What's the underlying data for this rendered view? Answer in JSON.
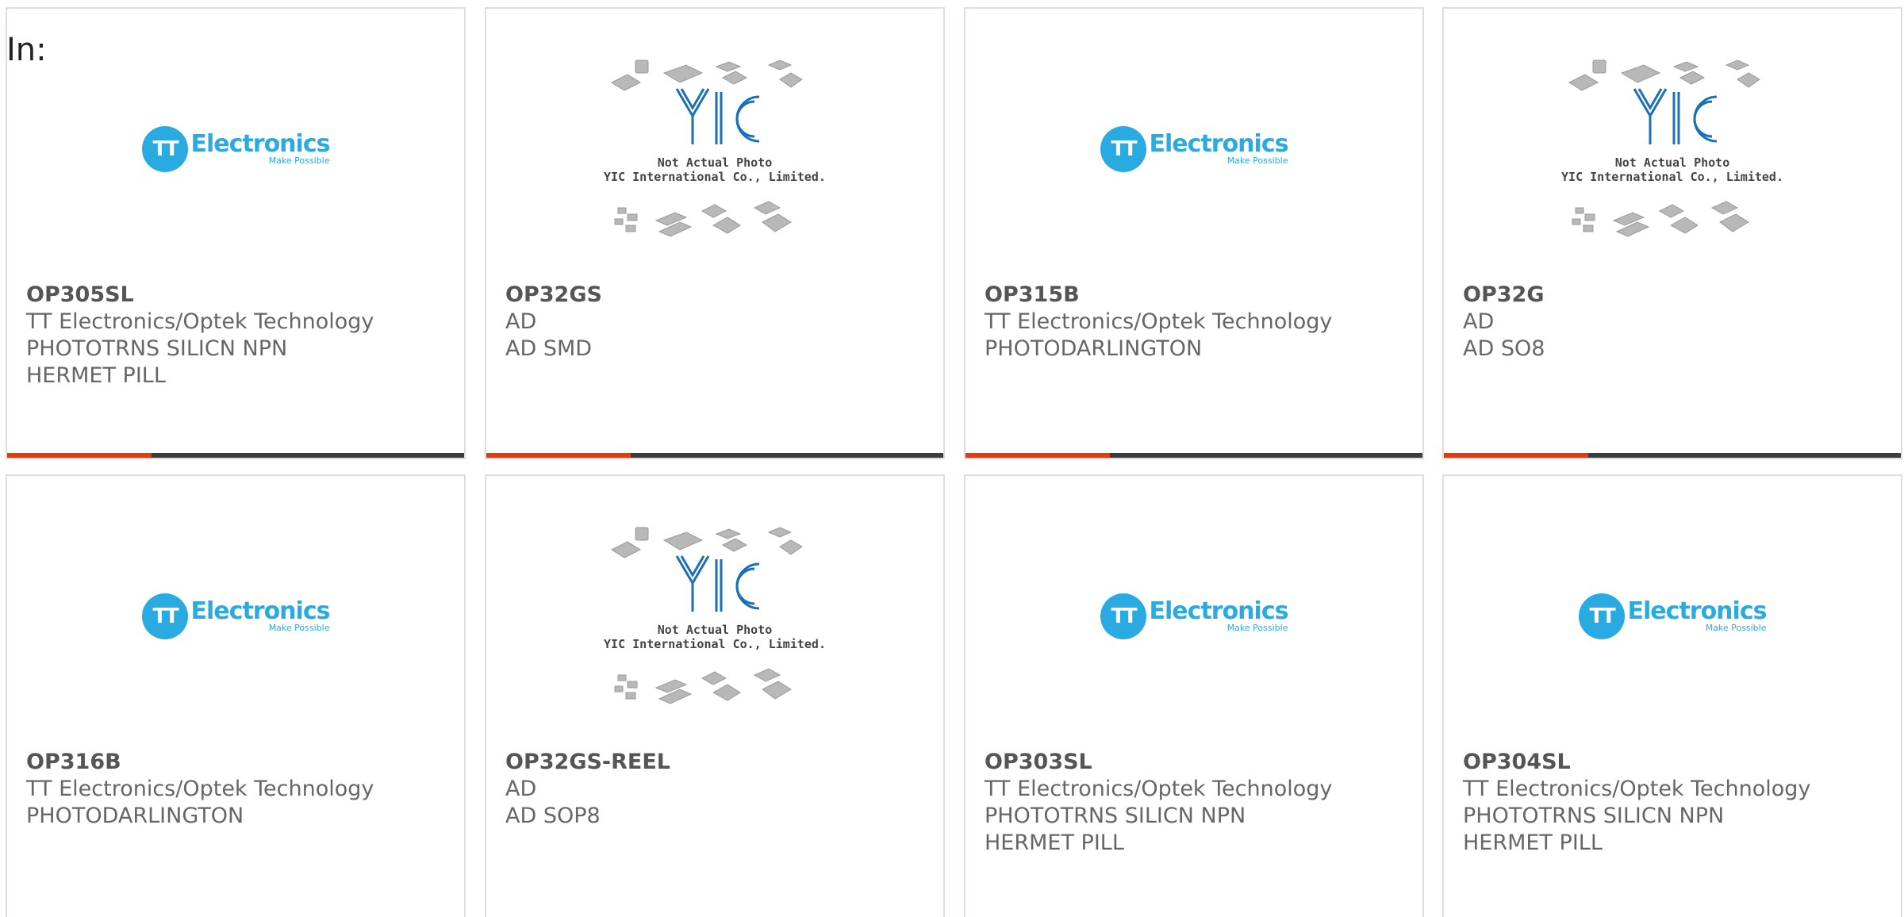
{
  "prefix_label": "In:",
  "products": [
    {
      "part_number": "OP305SL",
      "lines": [
        "TT Electronics/Optek Technology",
        "PHOTOTRNS SILICN NPN",
        "HERMET PILL"
      ],
      "image": "tt-electronics-logo"
    },
    {
      "part_number": "OP32GS",
      "lines": [
        "AD",
        "AD SMD"
      ],
      "image": "yic-placeholder"
    },
    {
      "part_number": "OP315B",
      "lines": [
        "TT Electronics/Optek Technology",
        "PHOTODARLINGTON"
      ],
      "image": "tt-electronics-logo"
    },
    {
      "part_number": "OP32G",
      "lines": [
        "AD",
        "AD SO8"
      ],
      "image": "yic-placeholder"
    },
    {
      "part_number": "OP316B",
      "lines": [
        "TT Electronics/Optek Technology",
        "PHOTODARLINGTON"
      ],
      "image": "tt-electronics-logo"
    },
    {
      "part_number": "OP32GS-REEL",
      "lines": [
        "AD",
        "AD SOP8"
      ],
      "image": "yic-placeholder"
    },
    {
      "part_number": "OP303SL",
      "lines": [
        "TT Electronics/Optek Technology",
        "PHOTOTRNS SILICN NPN",
        "HERMET PILL"
      ],
      "image": "tt-electronics-logo"
    },
    {
      "part_number": "OP304SL",
      "lines": [
        "TT Electronics/Optek Technology",
        "PHOTOTRNS SILICN NPN",
        "HERMET PILL"
      ],
      "image": "tt-electronics-logo"
    }
  ],
  "tt_logo": {
    "monogram": "TT",
    "word": "Electronics",
    "tagline": "Make Possible"
  },
  "yic_placeholder": {
    "monogram": "YIC",
    "caption_line1": "Not Actual Photo",
    "caption_line2": "YIC International Co., Limited."
  },
  "colors": {
    "accent": "#e03c12",
    "bar": "#3c3c3c",
    "tt_blue": "#29abe2",
    "yic_blue": "#1a6fb5"
  }
}
